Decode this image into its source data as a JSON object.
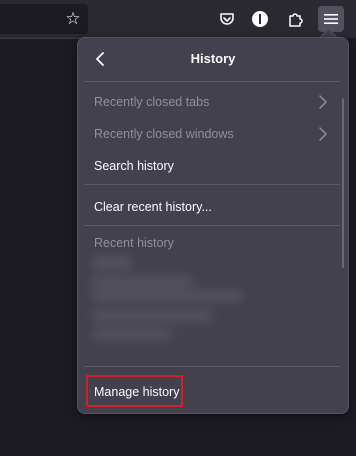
{
  "toolbar": {
    "icons": [
      "star-icon",
      "pocket-icon",
      "info-icon",
      "extensions-icon",
      "menu-icon"
    ]
  },
  "panel": {
    "title": "History",
    "items": [
      {
        "label": "Recently closed tabs",
        "disabled": true,
        "has_submenu": true
      },
      {
        "label": "Recently closed windows",
        "disabled": true,
        "has_submenu": true
      },
      {
        "label": "Search history",
        "disabled": false,
        "has_submenu": false
      },
      {
        "label": "Clear recent history...",
        "disabled": false,
        "has_submenu": false
      }
    ],
    "section_header": "Recent history",
    "footer_item": "Manage history"
  },
  "colors": {
    "panel_bg": "#42414d",
    "text": "#fbfbfe",
    "disabled_text": "#8f8f9d",
    "highlight_border": "#d21f2c"
  }
}
